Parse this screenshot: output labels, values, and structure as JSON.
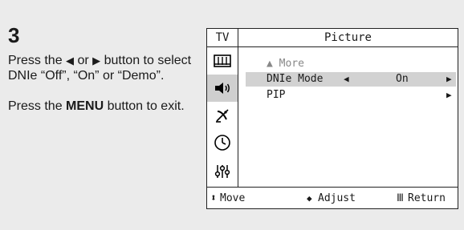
{
  "step": {
    "number": "3"
  },
  "instructions": {
    "line1_pre": "Press the ",
    "left_arrow": "◀",
    "line1_mid": " or ",
    "right_arrow": "▶",
    "line1_post": " button to select DNIe “Off”, “On” or “Demo”.",
    "line2_pre": "Press the ",
    "line2_bold": "MENU",
    "line2_post": " button to exit."
  },
  "osd": {
    "side_label": "TV",
    "side_icons": [
      "channel-list-icon",
      "speaker-icon",
      "satellite-icon",
      "clock-icon",
      "settings-sliders-icon"
    ],
    "title": "Picture",
    "rows": [
      {
        "label": "▲ More",
        "value": "",
        "left_arrow": "",
        "right_arrow": ""
      },
      {
        "label": "DNIe Mode",
        "value": "On",
        "left_arrow": "◀",
        "right_arrow": "▶"
      },
      {
        "label": "PIP",
        "value": "",
        "left_arrow": "",
        "right_arrow": "▶"
      }
    ],
    "footer": {
      "move_icon": "⬍",
      "move": "Move",
      "adjust_icon": "◆",
      "adjust": "Adjust",
      "return_icon": "Ⅲ",
      "return": "Return"
    }
  },
  "colors": {
    "panel_bg": "#ebebeb",
    "highlight": "#d2d2d2"
  }
}
